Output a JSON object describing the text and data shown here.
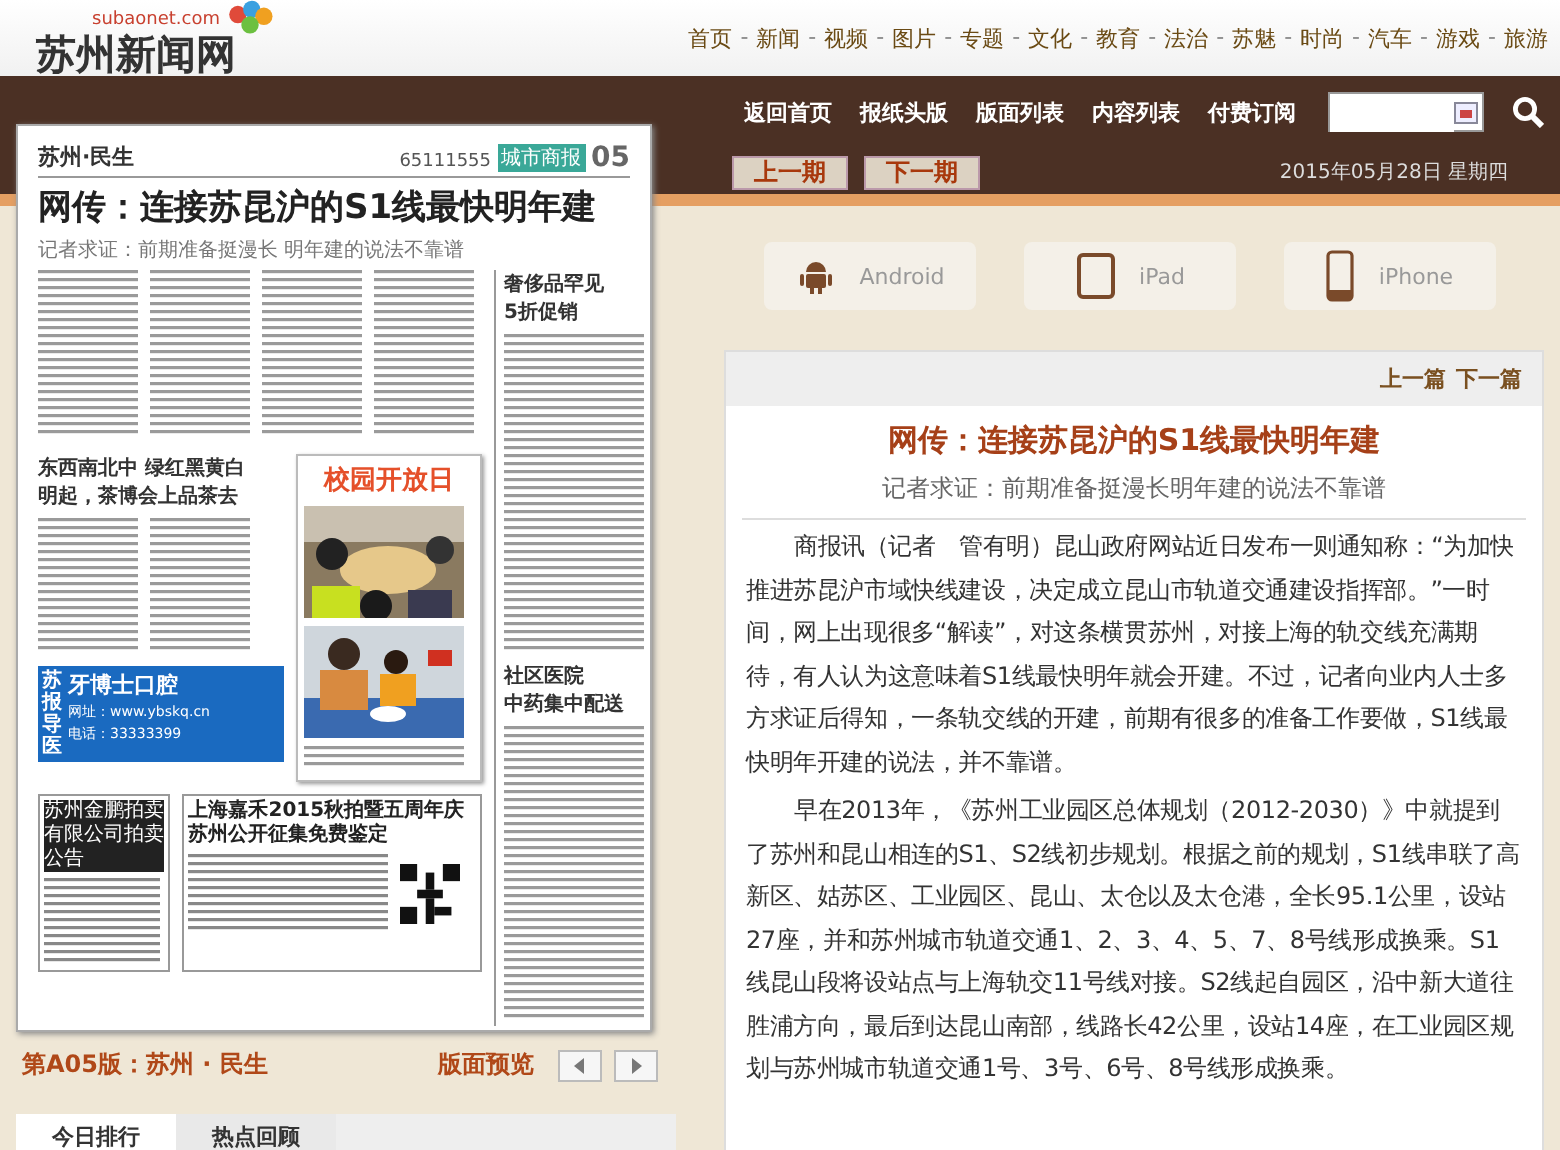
{
  "site": {
    "domain": "subaonet.com",
    "name": "苏州新闻网"
  },
  "nav": {
    "separator": "-",
    "items": [
      "首页",
      "新闻",
      "视频",
      "图片",
      "专题",
      "文化",
      "教育",
      "法治",
      "苏魅",
      "时尚",
      "汽车",
      "游戏",
      "旅游"
    ]
  },
  "toolbar": {
    "links": [
      "返回首页",
      "报纸头版",
      "版面列表",
      "内容列表",
      "付费订阅"
    ]
  },
  "issue_buttons": [
    "上一期",
    "下一期"
  ],
  "date": "2015年05月28日 星期四",
  "newspaper": {
    "section": "苏州·民生",
    "phone": "65111555",
    "paper": "城市商报",
    "page": "05",
    "headline": "网传：连接苏昆沪的S1线最快明年建",
    "deck": "记者求证：前期准备挺漫长 明年建的说法不靠谱",
    "story2_headline": [
      "东西南北中 绿红黑黄白",
      "明起，茶博会上品茶去"
    ],
    "photo_box_title": "校园开放日",
    "sidebar": [
      {
        "headline": [
          "奢侈品罕见",
          "5折促销"
        ]
      },
      {
        "headline": [
          "社区医院",
          "中药集中配送"
        ]
      }
    ],
    "ad": {
      "vertical": "苏报导医",
      "brand": "牙博士口腔",
      "web": "网址：www.ybskq.cn",
      "phone": "电话：33333399"
    },
    "notices": [
      "苏州金鹏拍卖有限公司拍卖公告",
      "上海嘉禾2015秋拍暨五周年庆苏州公开征集免费鉴定"
    ]
  },
  "page_footer": {
    "label": "第A05版：苏州 · 民生",
    "preview": "版面预览"
  },
  "tabs": [
    {
      "label": "今日排行",
      "selected": true
    },
    {
      "label": "热点回顾",
      "selected": false
    }
  ],
  "apps": [
    {
      "label": "Android",
      "kind": "android"
    },
    {
      "label": "iPad",
      "kind": "tablet"
    },
    {
      "label": "iPhone",
      "kind": "phone"
    }
  ],
  "article": {
    "nav": [
      "上一篇",
      "下一篇"
    ],
    "title": "网传：连接苏昆沪的S1线最快明年建",
    "subtitle": "记者求证：前期准备挺漫长明年建的说法不靠谱",
    "paragraphs": [
      "商报讯（记者　管有明）昆山政府网站近日发布一则通知称：“为加快推进苏昆沪市域快线建设，决定成立昆山市轨道交通建设指挥部。”一时间，网上出现很多“解读”，对这条横贯苏州，对接上海的轨交线充满期待，有人认为这意味着S1线最快明年就会开建。不过，记者向业内人士多方求证后得知，一条轨交线的开建，前期有很多的准备工作要做，S1线最快明年开建的说法，并不靠谱。",
      "早在2013年，《苏州工业园区总体规划（2012-2030）》中就提到了苏州和昆山相连的S1、S2线初步规划。根据之前的规划，S1线串联了高新区、姑苏区、工业园区、昆山、太仓以及太仓港，全长95.1公里，设站27座，并和苏州城市轨道交通1、2、3、4、5、7、8号线形成换乘。S1线昆山段将设站点与上海轨交11号线对接。S2线起自园区，沿中新大道往胜浦方向，最后到达昆山南部，线路长42公里，设站14座，在工业园区规划与苏州城市轨道交通1号、3号、6号、8号线形成换乘。"
    ]
  }
}
